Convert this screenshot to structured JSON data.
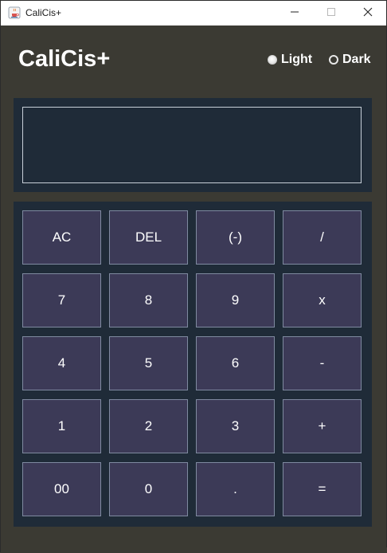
{
  "window": {
    "title": "CaliCis+",
    "icons": {
      "app": "java-cup-icon",
      "minimize": "minimize-icon",
      "maximize": "maximize-icon",
      "close": "close-icon"
    }
  },
  "header": {
    "title": "CaliCis+",
    "theme_options": [
      {
        "label": "Light",
        "selected": true
      },
      {
        "label": "Dark",
        "selected": false
      }
    ]
  },
  "display": {
    "value": ""
  },
  "keypad": {
    "rows": [
      [
        "AC",
        "DEL",
        "(-)",
        "/"
      ],
      [
        "7",
        "8",
        "9",
        "x"
      ],
      [
        "4",
        "5",
        "6",
        "-"
      ],
      [
        "1",
        "2",
        "3",
        "+"
      ],
      [
        "00",
        "0",
        ".",
        "="
      ]
    ]
  },
  "colors": {
    "window_bg": "#3b3a33",
    "panel_bg": "#1f2b38",
    "key_bg": "#3c3a57",
    "key_border": "#7f8aa0",
    "text": "#ffffff"
  }
}
